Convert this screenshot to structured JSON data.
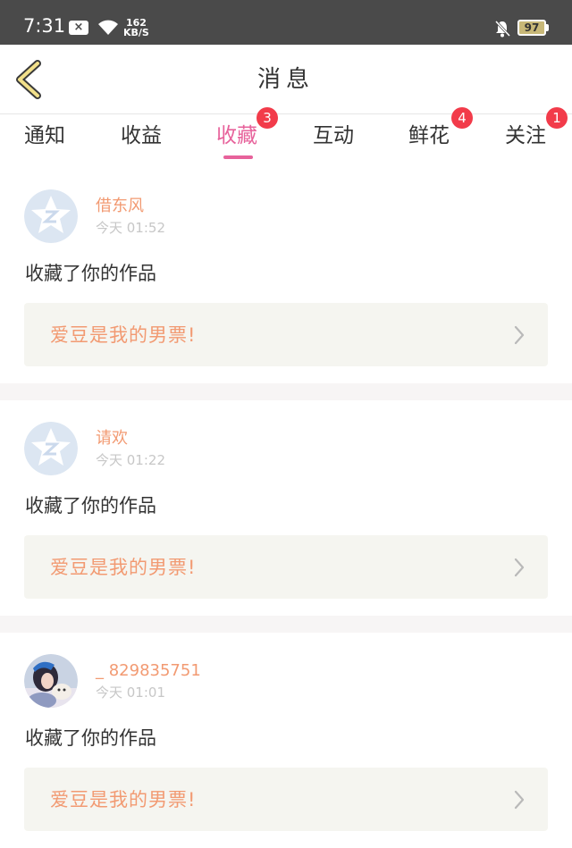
{
  "status_bar": {
    "time": "7:31",
    "notif_icon": "x-box-icon",
    "speed_value": "162",
    "speed_unit": "KB/S",
    "battery": "97"
  },
  "header": {
    "back_icon": "chevron-left-icon",
    "title": "消息"
  },
  "tabs": [
    {
      "label": "通知",
      "badge": ""
    },
    {
      "label": "收益",
      "badge": ""
    },
    {
      "label": "收藏",
      "badge": "3",
      "active": true
    },
    {
      "label": "互动",
      "badge": ""
    },
    {
      "label": "鲜花",
      "badge": "4"
    },
    {
      "label": "关注",
      "badge": "1"
    }
  ],
  "colors": {
    "accent": "#e7629b",
    "badge": "#f23b4a",
    "name": "#f29a72",
    "card_bg": "#f5f5f0"
  },
  "messages": [
    {
      "user": "借东风",
      "time": "今天 01:52",
      "action": "收藏了你的作品",
      "work": "爱豆是我的男票!",
      "avatar": "default-avatar-icon"
    },
    {
      "user": "请欢",
      "time": "今天 01:22",
      "action": "收藏了你的作品",
      "work": "爱豆是我的男票!",
      "avatar": "default-avatar-icon"
    },
    {
      "user": "_ 829835751",
      "time": "今天 01:01",
      "action": "收藏了你的作品",
      "work": "爱豆是我的男票!",
      "avatar": "photo-avatar"
    }
  ]
}
